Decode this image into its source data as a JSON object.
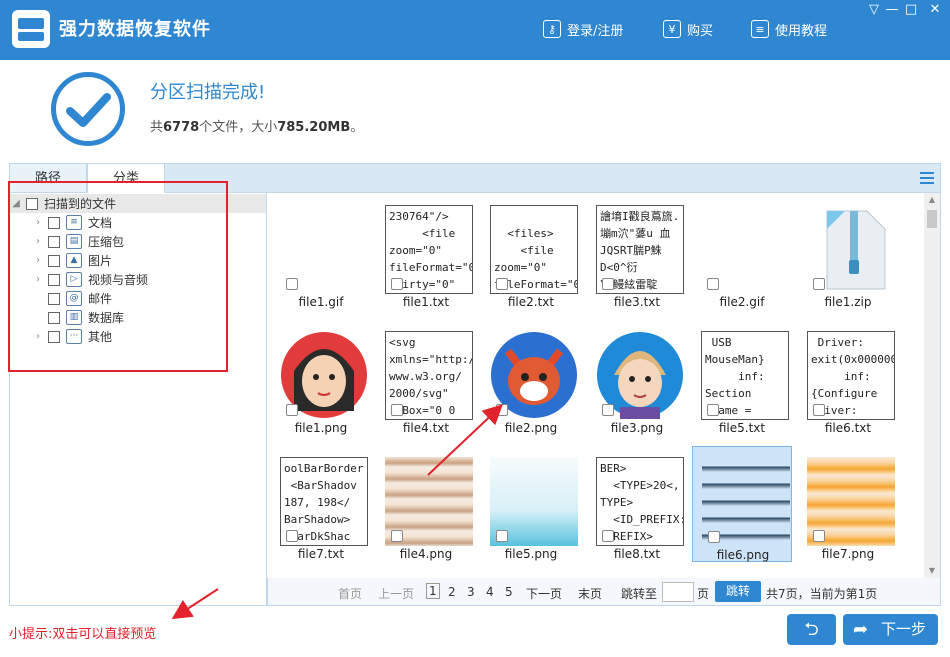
{
  "app": {
    "title": "强力数据恢复软件"
  },
  "top_actions": {
    "login": "登录/注册",
    "buy": "购买",
    "tutorial": "使用教程"
  },
  "window_controls": {
    "menu": "▽",
    "min": "—",
    "max": "□",
    "close": "✕"
  },
  "result": {
    "title": "分区扫描完成!",
    "prefix": "共",
    "count": "6778",
    "mid": "个文件，大小",
    "size": "785.20MB",
    "suffix": "。"
  },
  "tabs": [
    {
      "label": "路径"
    },
    {
      "label": "分类"
    }
  ],
  "tree": {
    "root": "扫描到的文件",
    "items": [
      {
        "label": "文档",
        "icon": "document-icon"
      },
      {
        "label": "压缩包",
        "icon": "archive-icon"
      },
      {
        "label": "图片",
        "icon": "image-icon"
      },
      {
        "label": "视频与音频",
        "icon": "video-icon"
      },
      {
        "label": "邮件",
        "icon": "mail-icon"
      },
      {
        "label": "数据库",
        "icon": "database-icon"
      },
      {
        "label": "其他",
        "icon": "other-icon"
      }
    ]
  },
  "files": [
    {
      "name": "file1.gif",
      "kind": "empty"
    },
    {
      "name": "file1.txt",
      "kind": "txt",
      "content": "230764\"/>\n     <file\nzoom=\"0\"\nfileFormat=\"0\n dirty=\"0\""
    },
    {
      "name": "file2.txt",
      "kind": "txt",
      "content": "\n  <files>\n    <file\nzoom=\"0\"\nfileFormat=\"0"
    },
    {
      "name": "file3.txt",
      "kind": "txt",
      "content": "譮堉I戳良蔦旒.\n塴m泬\"蔢u 血\nJQSRT腨P鮢\nD<0^衍\n\\'鳗絃雷聢"
    },
    {
      "name": "file2.gif",
      "kind": "empty"
    },
    {
      "name": "file1.zip",
      "kind": "zip"
    },
    {
      "name": "file1.png",
      "kind": "face1"
    },
    {
      "name": "file4.txt",
      "kind": "txt",
      "content": "<svg\nxmlns=\"http:/\nwww.w3.org/\n2000/svg\"\n wBox=\"0 0"
    },
    {
      "name": "file2.png",
      "kind": "fox"
    },
    {
      "name": "file3.png",
      "kind": "face2"
    },
    {
      "name": "file5.txt",
      "kind": "txt",
      "content": " USB\nMouseMan}\n     inf:\nSection\n  ame ="
    },
    {
      "name": "file6.txt",
      "kind": "txt",
      "content": " Driver:\nexit(0x000000\n     inf:\n{Configure\n river:"
    },
    {
      "name": "file7.txt",
      "kind": "txt",
      "content": "oolBarBorder\n <BarShadov\n187, 198</\nBarShadow>\n BarDkShac"
    },
    {
      "name": "file4.png",
      "kind": "stripes"
    },
    {
      "name": "file5.png",
      "kind": "gradient"
    },
    {
      "name": "file8.txt",
      "kind": "txt",
      "content": "BER>\n  <TYPE>20<,\nTYPE>\n  <ID_PREFIX:\n PREFIX>"
    },
    {
      "name": "file6.png",
      "kind": "bolts"
    },
    {
      "name": "file7.png",
      "kind": "orange"
    }
  ],
  "pager": {
    "first": "首页",
    "prev": "上一页",
    "pages": [
      "1",
      "2",
      "3",
      "4",
      "5"
    ],
    "next": "下一页",
    "last": "末页",
    "jump_label": "跳转至",
    "page_unit": "页",
    "jump_btn": "跳转",
    "status": "共7页，当前为第1页"
  },
  "hint": "小提示:双击可以直接预览",
  "buttons": {
    "back": "⮌",
    "next": "下一步"
  },
  "colors": {
    "primary": "#2f87d1",
    "annotation": "#e2222c"
  }
}
